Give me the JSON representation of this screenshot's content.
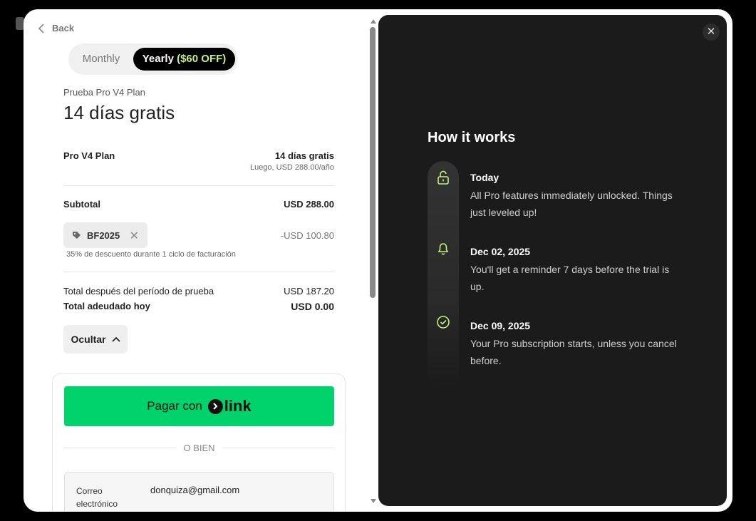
{
  "back_label": "Back",
  "billing_toggle": {
    "monthly_label": "Monthly",
    "yearly_label": "Yearly",
    "yearly_discount": "($60 OFF)",
    "selected": "yearly"
  },
  "plan": {
    "small_title": "Prueba Pro V4 Plan",
    "headline": "14 días gratis"
  },
  "line_item": {
    "name": "Pro V4 Plan",
    "value": "14 días gratis",
    "sub_value": "Luego, USD 288.00/año"
  },
  "subtotal": {
    "label": "Subtotal",
    "value": "USD 288.00"
  },
  "coupon": {
    "code": "BF2025",
    "amount": "-USD 100.80",
    "note": "35% de descuento durante 1 ciclo de facturación"
  },
  "totals": {
    "after_trial_label": "Total después del período de prueba",
    "after_trial_value": "USD 187.20",
    "due_today_label": "Total adeudado hoy",
    "due_today_value": "USD 0.00"
  },
  "hide_label": "Ocultar",
  "payment": {
    "pay_with_label": "Pagar con",
    "link_brand": "link",
    "or_label": "O BIEN",
    "email_label": "Correo electrónico",
    "email_value": "donquiza@gmail.com"
  },
  "how_it_works": {
    "title": "How it works",
    "steps": [
      {
        "icon": "unlock-icon",
        "title": "Today",
        "desc": "All Pro features immediately unlocked. Things just leveled up!"
      },
      {
        "icon": "bell-icon",
        "title": "Dec 02, 2025",
        "desc": "You'll get a reminder 7 days before the trial is up."
      },
      {
        "icon": "check-circle-icon",
        "title": "Dec 09, 2025",
        "desc": "Your Pro subscription starts, unless you cancel before."
      }
    ]
  },
  "colors": {
    "accent_green": "#00d36b",
    "icon_lime": "#c7f07a",
    "dark_panel": "#1b1b1b"
  }
}
